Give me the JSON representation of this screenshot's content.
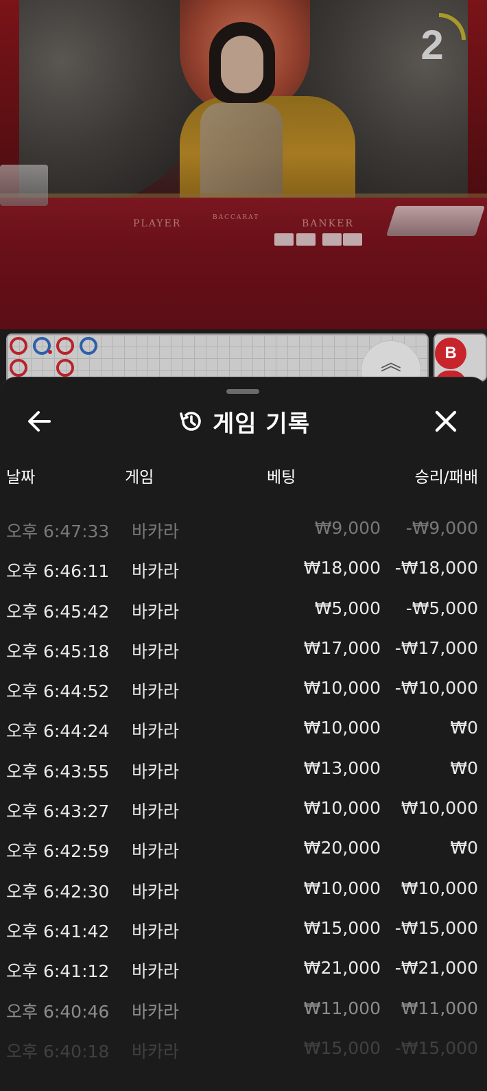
{
  "video": {
    "timer_value": "2",
    "table_labels": {
      "player": "PLAYER",
      "banker": "BANKER",
      "brand": "BACCARAT"
    },
    "roadmap_badge": "B"
  },
  "sheet": {
    "title": "게임 기록",
    "icons": {
      "back": "arrow-left-icon",
      "history": "history-icon",
      "close": "close-icon"
    },
    "columns": {
      "date": "날짜",
      "game": "게임",
      "bet": "베팅",
      "result": "승리/패배"
    },
    "rows": [
      {
        "time": "오후 6:47:33",
        "game": "바카라",
        "bet": "₩9,000",
        "result": "-₩9,000"
      },
      {
        "time": "오후 6:46:11",
        "game": "바카라",
        "bet": "₩18,000",
        "result": "-₩18,000"
      },
      {
        "time": "오후 6:45:42",
        "game": "바카라",
        "bet": "₩5,000",
        "result": "-₩5,000"
      },
      {
        "time": "오후 6:45:18",
        "game": "바카라",
        "bet": "₩17,000",
        "result": "-₩17,000"
      },
      {
        "time": "오후 6:44:52",
        "game": "바카라",
        "bet": "₩10,000",
        "result": "-₩10,000"
      },
      {
        "time": "오후 6:44:24",
        "game": "바카라",
        "bet": "₩10,000",
        "result": "₩0"
      },
      {
        "time": "오후 6:43:55",
        "game": "바카라",
        "bet": "₩13,000",
        "result": "₩0"
      },
      {
        "time": "오후 6:43:27",
        "game": "바카라",
        "bet": "₩10,000",
        "result": "₩10,000"
      },
      {
        "time": "오후 6:42:59",
        "game": "바카라",
        "bet": "₩20,000",
        "result": "₩0"
      },
      {
        "time": "오후 6:42:30",
        "game": "바카라",
        "bet": "₩10,000",
        "result": "₩10,000"
      },
      {
        "time": "오후 6:41:42",
        "game": "바카라",
        "bet": "₩15,000",
        "result": "-₩15,000"
      },
      {
        "time": "오후 6:41:12",
        "game": "바카라",
        "bet": "₩21,000",
        "result": "-₩21,000"
      },
      {
        "time": "오후 6:40:46",
        "game": "바카라",
        "bet": "₩11,000",
        "result": "₩11,000"
      },
      {
        "time": "오후 6:40:18",
        "game": "바카라",
        "bet": "₩15,000",
        "result": "-₩15,000"
      }
    ]
  },
  "colors": {
    "sheet_bg": "#1b1b1b",
    "text": "#ffffff",
    "banker_red": "#c8242c",
    "player_blue": "#2f5fa8"
  }
}
